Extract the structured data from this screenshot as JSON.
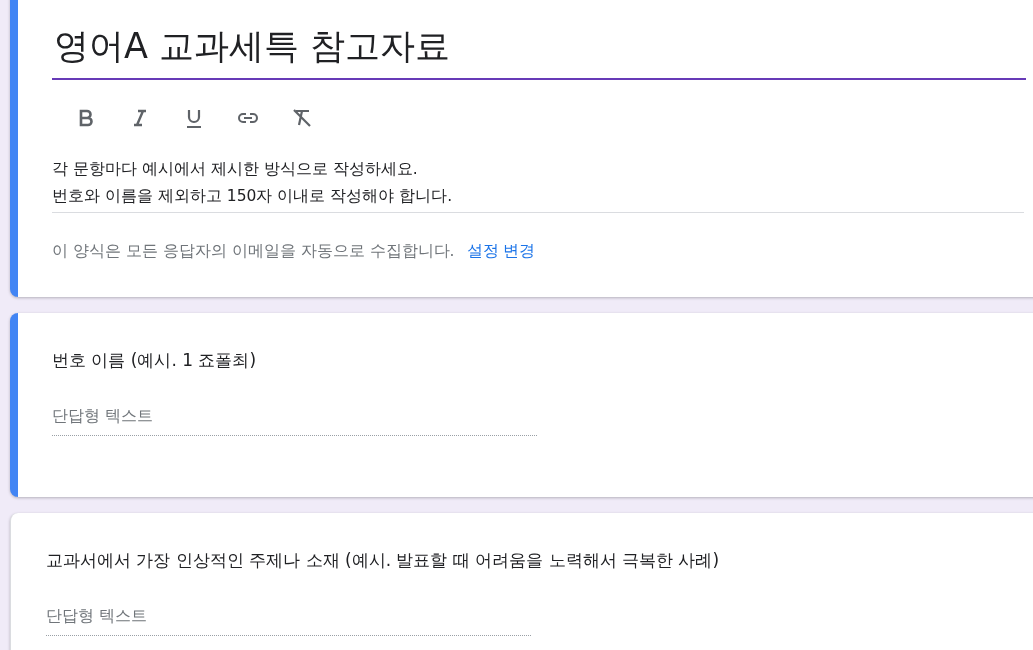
{
  "header": {
    "selected": true,
    "title": "영어A 교과세특 참고자료",
    "toolbar": [
      {
        "kind": "bold"
      },
      {
        "kind": "italic"
      },
      {
        "kind": "underline"
      },
      {
        "kind": "link"
      },
      {
        "kind": "clear"
      }
    ],
    "description": [
      "각 문항마다 예시에서 제시한 방식으로 작성하세요.",
      "번호와 이름을 제외하고 150자 이내로 작성해야 합니다."
    ],
    "email_note": "이 양식은 모든 응답자의 이메일을 자동으로 수집합니다.",
    "settings_link": "설정 변경"
  },
  "questions": [
    {
      "title": "번호 이름 (예시. 1 죠폴최)",
      "placeholder": "단답형 텍스트",
      "selected": true
    },
    {
      "title": "교과서에서 가장 인상적인 주제나 소재 (예시. 발표할 때 어려움을 노력해서 극복한 사례)",
      "placeholder": "단답형 텍스트",
      "selected": false
    }
  ]
}
